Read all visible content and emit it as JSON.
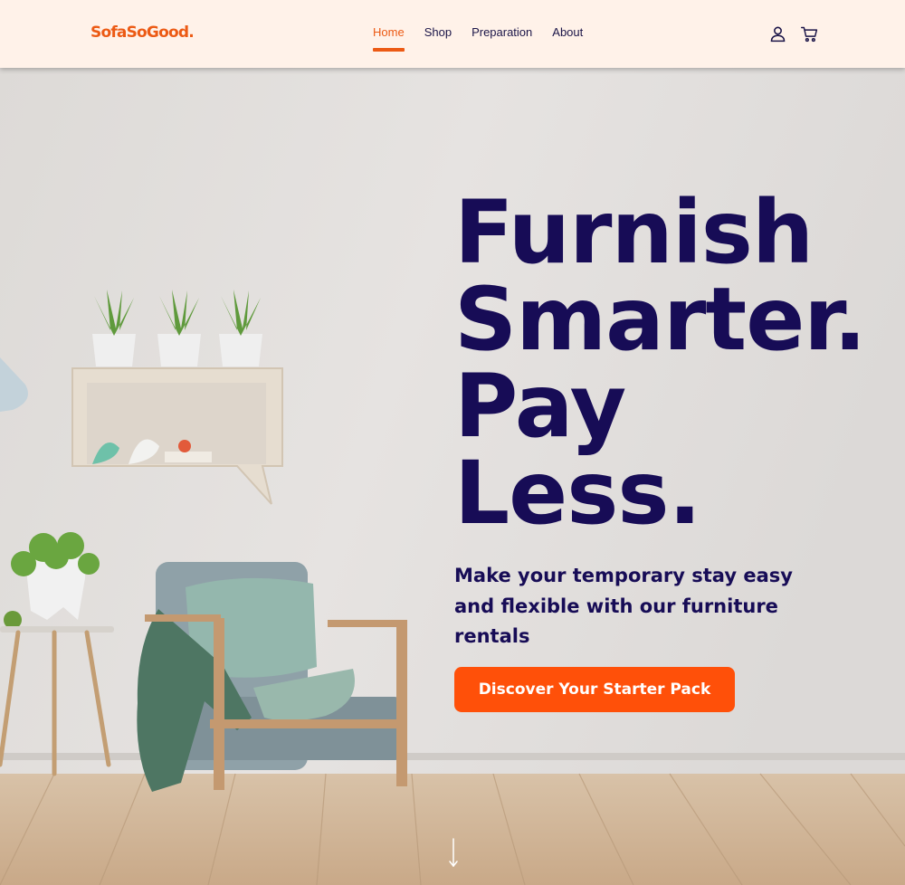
{
  "brand": {
    "logo_text": "SofaSoGood.",
    "accent_color": "#ec5a14",
    "navy_color": "#170c56"
  },
  "nav": {
    "items": [
      {
        "label": "Home",
        "active": true
      },
      {
        "label": "Shop",
        "active": false
      },
      {
        "label": "Preparation",
        "active": false
      },
      {
        "label": "About",
        "active": false
      }
    ]
  },
  "header_icons": {
    "account": "user-icon",
    "cart": "cart-icon"
  },
  "hero": {
    "headline_lines": [
      "Furnish",
      "Smarter.",
      "Pay",
      "Less."
    ],
    "subheading": "Make your temporary stay easy and flexible with our furniture rentals",
    "cta_label": "Discover Your Starter Pack",
    "cta_color": "#ff5009",
    "scroll_icon": "arrow-down-icon"
  }
}
